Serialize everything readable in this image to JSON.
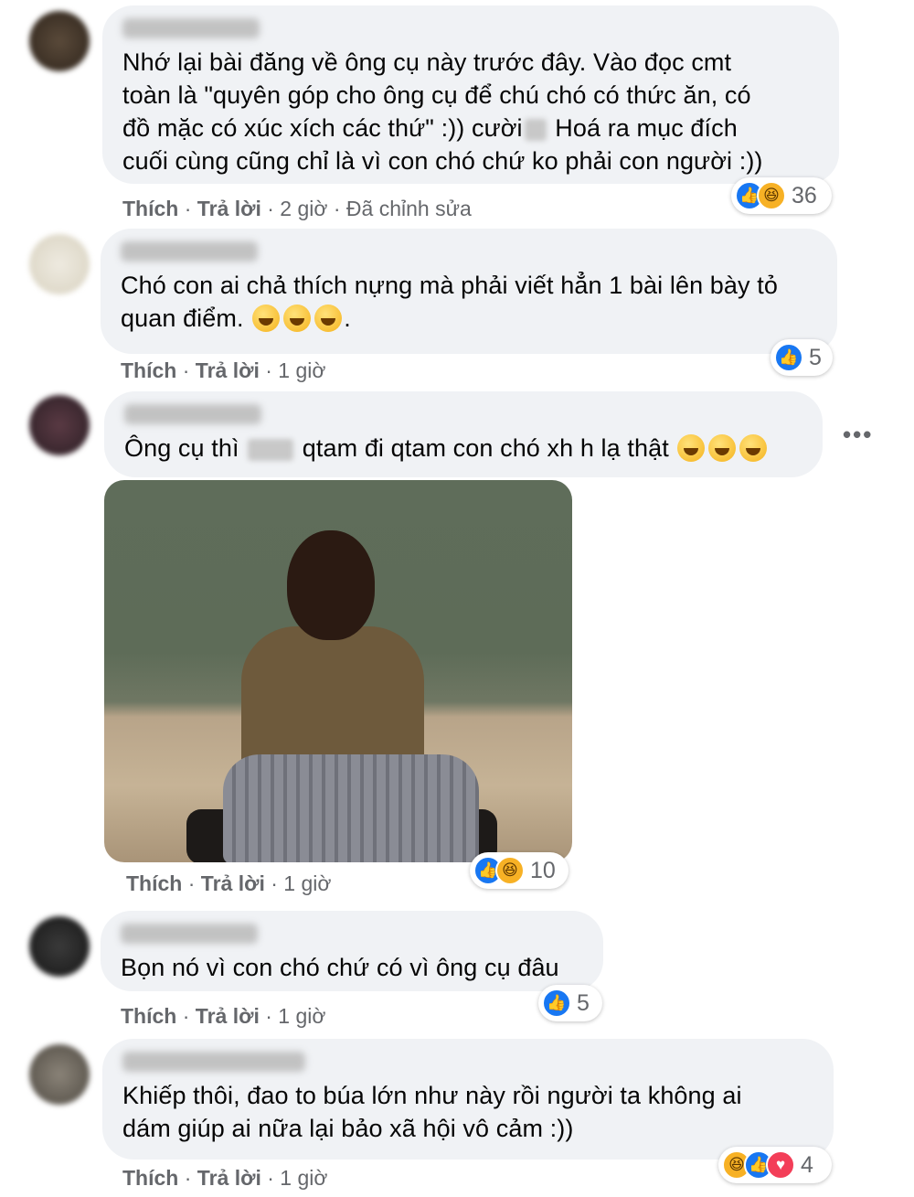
{
  "comments": [
    {
      "text": "Nhớ lại bài đăng về ông cụ này trước đây. Vào đọc cmt\ntoàn là \"quyên góp cho ông cụ để chú chó có thức ăn, có\nđồ mặc có xúc xích các thứ\" :)) cười",
      "text_after": " Hoá ra mục đích\ncuối cùng cũng chỉ là vì con chó chứ ko phải con người :))",
      "like": "Thích",
      "reply": "Trả lời",
      "time": "2 giờ",
      "edited": "Đã chỉnh sửa",
      "reaction_count": "36"
    },
    {
      "text": "Chó con ai chả thích nựng mà phải viết hẳn 1 bài lên bày tỏ\nquan điểm.",
      "text_after": ".",
      "like": "Thích",
      "reply": "Trả lời",
      "time": "1 giờ",
      "reaction_count": "5"
    },
    {
      "text": "Ông cụ thì",
      "text_after": " qtam đi qtam con chó xh h lạ thật",
      "like": "Thích",
      "reply": "Trả lời",
      "time": "1 giờ",
      "reaction_count": "10"
    },
    {
      "text": "Bọn nó vì con chó chứ có vì ông cụ đâu",
      "like": "Thích",
      "reply": "Trả lời",
      "time": "1 giờ",
      "reaction_count": "5"
    },
    {
      "text": "Khiếp thôi, đao to búa lớn như này rồi người ta không ai\ndám giúp ai nữa lại bảo xã hội vô cảm :))",
      "like": "Thích",
      "reply": "Trả lời",
      "time": "1 giờ",
      "reaction_count": "4"
    }
  ],
  "more_options": "•••",
  "separator": " · ",
  "colors": {
    "bubble": "#f0f2f5",
    "meta_text": "#65676b",
    "like_blue": "#1877f2",
    "haha_yellow": "#f7b125",
    "love_red": "#f33e58"
  }
}
